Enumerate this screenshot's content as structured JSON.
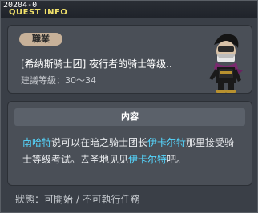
{
  "window": {
    "quest_id": "20204-0",
    "title": "QUEST INFO"
  },
  "summary": {
    "job_badge": "職業",
    "quest_name": "[希纳斯骑士团] 夜行者的骑士等级..",
    "recommended_level": "建議等級：30～34"
  },
  "content": {
    "header": "内容",
    "segments": [
      {
        "text": "南哈特",
        "highlight": true
      },
      {
        "text": "说可以在暗之骑士团长",
        "highlight": false
      },
      {
        "text": "伊卡尔特",
        "highlight": true
      },
      {
        "text": "那里接受骑士等级考试。去圣地见见",
        "highlight": false
      },
      {
        "text": "伊卡尔特",
        "highlight": true
      },
      {
        "text": "吧。",
        "highlight": false
      }
    ]
  },
  "status": {
    "text": "狀態：可開始 / 不可執行任務"
  },
  "colors": {
    "highlight": "#55d7ff",
    "title": "#f2e26a",
    "badge": "#c7b199"
  }
}
